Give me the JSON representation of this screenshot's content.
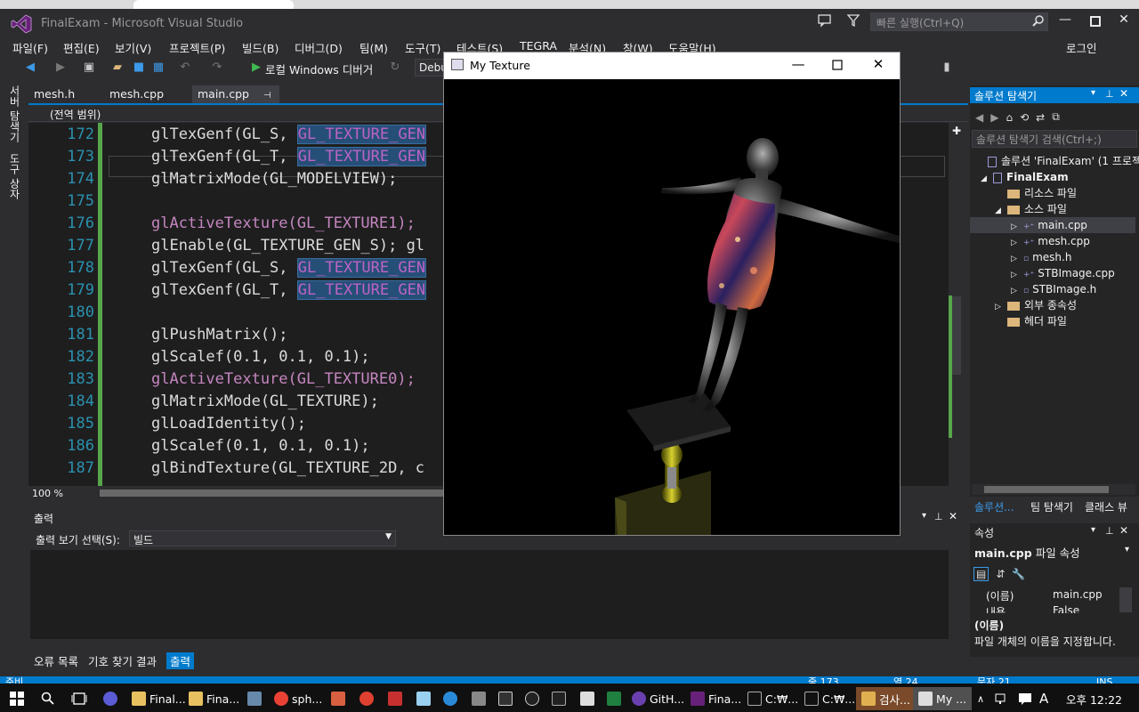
{
  "app": {
    "title": "FinalExam - Microsoft Visual Studio",
    "quick_launch_placeholder": "빠른 실행(Ctrl+Q)",
    "login": "로그인",
    "colors": {
      "accent": "#007acc",
      "chrome": "#2d2d30",
      "editor_bg": "#1e1e1e"
    }
  },
  "menu": [
    "파일(F)",
    "편집(E)",
    "보기(V)",
    "프로젝트(P)",
    "빌드(B)",
    "디버그(D)",
    "팀(M)",
    "도구(T)",
    "테스트(S)",
    "TEGRA",
    "분석(N)",
    "창(W)",
    "도움말(H)"
  ],
  "toolbar": {
    "debugger_label": "로컬 Windows 디버거",
    "config": "Debug",
    "icons": [
      "back-icon",
      "forward-icon",
      "new-project-icon",
      "open-icon",
      "save-icon",
      "save-all-icon",
      "undo-icon",
      "redo-icon",
      "start-debug-icon",
      "refresh-icon"
    ]
  },
  "left_strip": [
    "서버 탐색기",
    "도구 상자"
  ],
  "doc_tabs": [
    {
      "label": "mesh.h"
    },
    {
      "label": "mesh.cpp"
    },
    {
      "label": "main.cpp",
      "active": true
    }
  ],
  "scope": "(전역 범위)",
  "code_lines": [
    {
      "n": "172",
      "text": "glTexGenf(GL_S, GL_TEXTURE_GEN"
    },
    {
      "n": "173",
      "text": "glTexGenf(GL_T, GL_TEXTURE_GEN"
    },
    {
      "n": "174",
      "text": "glMatrixMode(GL_MODELVIEW);"
    },
    {
      "n": "175",
      "text": ""
    },
    {
      "n": "176",
      "text": "glActiveTexture(GL_TEXTURE1);"
    },
    {
      "n": "177",
      "text": "glEnable(GL_TEXTURE_GEN_S); gl"
    },
    {
      "n": "178",
      "text": "glTexGenf(GL_S, GL_TEXTURE_GEN"
    },
    {
      "n": "179",
      "text": "glTexGenf(GL_T, GL_TEXTURE_GEN"
    },
    {
      "n": "180",
      "text": ""
    },
    {
      "n": "181",
      "text": "glPushMatrix();"
    },
    {
      "n": "182",
      "text": "glScalef(0.1, 0.1, 0.1);"
    },
    {
      "n": "183",
      "text": "glActiveTexture(GL_TEXTURE0);"
    },
    {
      "n": "184",
      "text": "glMatrixMode(GL_TEXTURE);"
    },
    {
      "n": "185",
      "text": "glLoadIdentity();"
    },
    {
      "n": "186",
      "text": "glScalef(0.1, 0.1, 0.1);"
    },
    {
      "n": "187",
      "text": "glBindTexture(GL_TEXTURE_2D, c"
    }
  ],
  "editor": {
    "zoom": "100 %"
  },
  "output": {
    "title": "출력",
    "source_label": "출력 보기 선택(S):",
    "source_value": "빌드"
  },
  "bottom_tabs": [
    "오류 목록",
    "기호 찾기 결과",
    "출력"
  ],
  "status": {
    "left": "준비",
    "line": "줄 173",
    "col": "열 24",
    "ch": "문자 21",
    "mode": "INS"
  },
  "solution_explorer": {
    "title": "솔루션 탐색기",
    "search_placeholder": "솔루션 탐색기 검색(Ctrl+;)",
    "items": [
      {
        "label": "솔루션 'FinalExam' (1 프로젝",
        "kind": "solution"
      },
      {
        "label": "FinalExam",
        "kind": "project"
      },
      {
        "label": "리소스 파일",
        "kind": "folder"
      },
      {
        "label": "소스 파일",
        "kind": "folder"
      },
      {
        "label": "main.cpp",
        "kind": "cpp",
        "selected": true
      },
      {
        "label": "mesh.cpp",
        "kind": "cpp"
      },
      {
        "label": "mesh.h",
        "kind": "h"
      },
      {
        "label": "STBImage.cpp",
        "kind": "cpp"
      },
      {
        "label": "STBImage.h",
        "kind": "h"
      },
      {
        "label": "외부 종속성",
        "kind": "folder"
      },
      {
        "label": "헤더 파일",
        "kind": "folder"
      }
    ],
    "tabs": [
      "솔루션...",
      "팀 탐색기",
      "클래스 뷰"
    ]
  },
  "properties": {
    "title": "속성",
    "subject": "main.cpp",
    "subject_suffix": "파일 속성",
    "rows": [
      {
        "name": "(이름)",
        "value": "main.cpp"
      },
      {
        "name": "내용",
        "value": "False"
      }
    ],
    "desc_title": "(이름)",
    "desc": "파일 개체의 이름을 지정합니다."
  },
  "texture_window": {
    "title": "My Texture"
  },
  "taskbar": {
    "items": [
      "Final...",
      "Fina...",
      "sph...",
      "GitH...",
      "Fina...",
      "C:₩...",
      "C:₩...",
      "검사...",
      "My ..."
    ],
    "ime": "A",
    "clock": "오후 12:22"
  }
}
